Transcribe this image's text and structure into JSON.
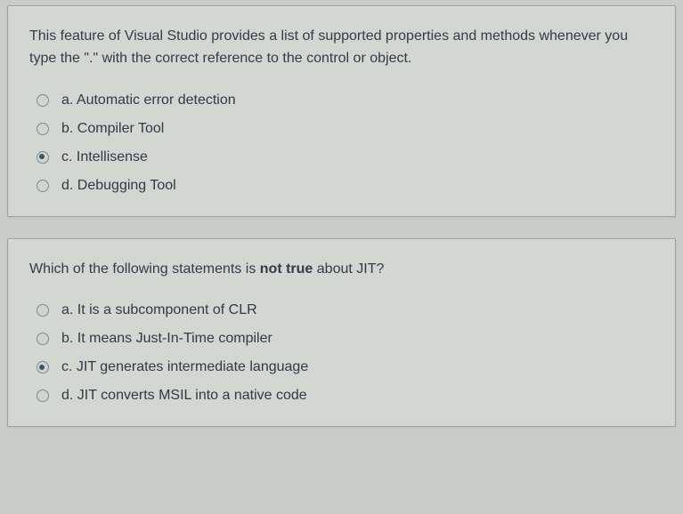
{
  "questions": [
    {
      "text_parts": {
        "pre": "This feature of Visual Studio provides a list of supported properties and methods whenever you type the \".\" with the correct reference to the control or object."
      },
      "options": [
        {
          "label": "a. Automatic error detection",
          "selected": false
        },
        {
          "label": "b. Compiler Tool",
          "selected": false
        },
        {
          "label": "c. Intellisense",
          "selected": true
        },
        {
          "label": "d. Debugging Tool",
          "selected": false
        }
      ]
    },
    {
      "text_parts": {
        "pre": "Which of the following statements is ",
        "bold": "not true",
        "post": " about JIT?"
      },
      "options": [
        {
          "label": "a. It is a subcomponent of CLR",
          "selected": false
        },
        {
          "label": "b. It means Just-In-Time compiler",
          "selected": false
        },
        {
          "label": "c. JIT generates intermediate language",
          "selected": true
        },
        {
          "label": "d. JIT converts MSIL into a native code",
          "selected": false
        }
      ]
    }
  ]
}
